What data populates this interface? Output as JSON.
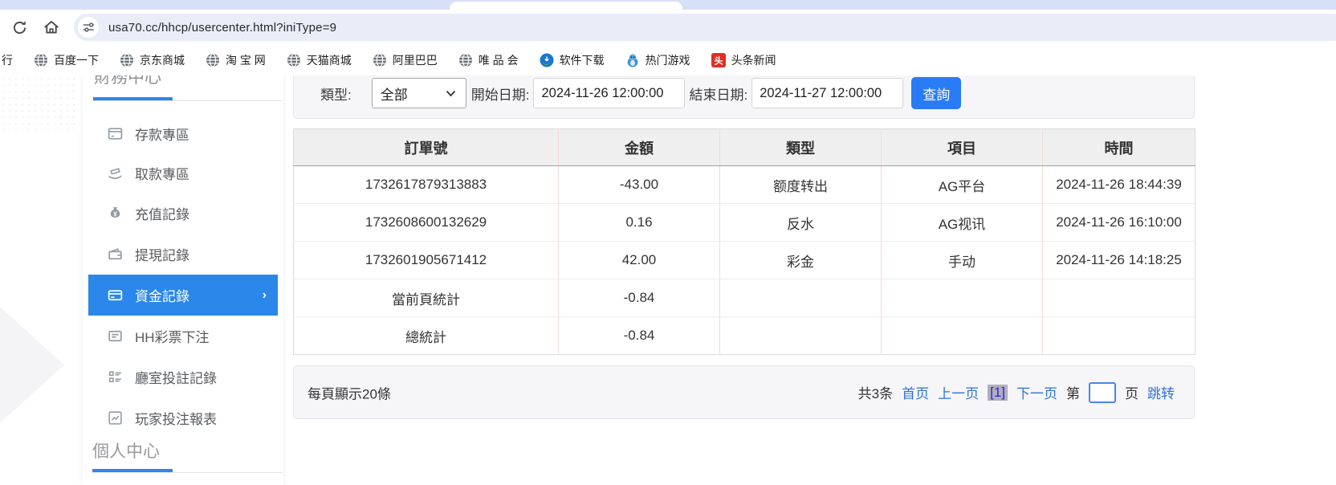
{
  "browser": {
    "url": "usa70.cc/hhcp/usercenter.html?iniType=9",
    "bookmarks": [
      {
        "label": "行",
        "icon": "none"
      },
      {
        "label": "百度一下",
        "icon": "globe"
      },
      {
        "label": "京东商城",
        "icon": "globe"
      },
      {
        "label": "淘 宝 网",
        "icon": "globe"
      },
      {
        "label": "天猫商城",
        "icon": "globe"
      },
      {
        "label": "阿里巴巴",
        "icon": "globe"
      },
      {
        "label": "唯 品 会",
        "icon": "globe"
      },
      {
        "label": "软件下载",
        "icon": "software"
      },
      {
        "label": "热门游戏",
        "icon": "penguin"
      },
      {
        "label": "头条新闻",
        "icon": "toutiao"
      }
    ]
  },
  "sidebar": {
    "finance_heading": "財務中心",
    "personal_heading": "個人中心",
    "items": [
      {
        "label": "存款專區",
        "icon": "deposit-icon",
        "active": false
      },
      {
        "label": "取款專區",
        "icon": "withdraw-icon",
        "active": false
      },
      {
        "label": "充值記錄",
        "icon": "recharge-icon",
        "active": false
      },
      {
        "label": "提現記錄",
        "icon": "cashout-icon",
        "active": false
      },
      {
        "label": "資金記錄",
        "icon": "funds-icon",
        "active": true
      },
      {
        "label": "HH彩票下注",
        "icon": "lottery-icon",
        "active": false
      },
      {
        "label": "廳室投註記錄",
        "icon": "hall-icon",
        "active": false
      },
      {
        "label": "玩家投注報表",
        "icon": "report-icon",
        "active": false
      }
    ]
  },
  "filters": {
    "type_label": "類型:",
    "type_value": "全部",
    "start_label": "開始日期:",
    "start_value": "2024-11-26 12:00:00",
    "end_label": "結束日期:",
    "end_value": "2024-11-27 12:00:00",
    "search_label": "查詢"
  },
  "table": {
    "headers": [
      "訂單號",
      "金額",
      "類型",
      "項目",
      "時間"
    ],
    "rows": [
      [
        "1732617879313883",
        "-43.00",
        "额度转出",
        "AG平台",
        "2024-11-26 18:44:39"
      ],
      [
        "1732608600132629",
        "0.16",
        "反水",
        "AG视讯",
        "2024-11-26 16:10:00"
      ],
      [
        "1732601905671412",
        "42.00",
        "彩金",
        "手动",
        "2024-11-26 14:18:25"
      ],
      [
        "當前頁統計",
        "-0.84",
        "",
        "",
        ""
      ],
      [
        "總統計",
        "-0.84",
        "",
        "",
        ""
      ]
    ]
  },
  "pager": {
    "page_size_label": "每頁顯示20條",
    "total_label": "共3条",
    "first_label": "首页",
    "prev_label": "上一页",
    "current_page": "[1]",
    "next_label": "下一页",
    "jump_prefix": "第",
    "jump_suffix": "页",
    "jump_label": "跳转",
    "jump_value": ""
  },
  "colors": {
    "accent_blue": "#2b87e9",
    "button_blue": "#2a7cf5",
    "link_blue": "#3071d8",
    "column_divider_pink": "#f3dcdc",
    "tabstrip_lavender": "#d6e0f7"
  }
}
